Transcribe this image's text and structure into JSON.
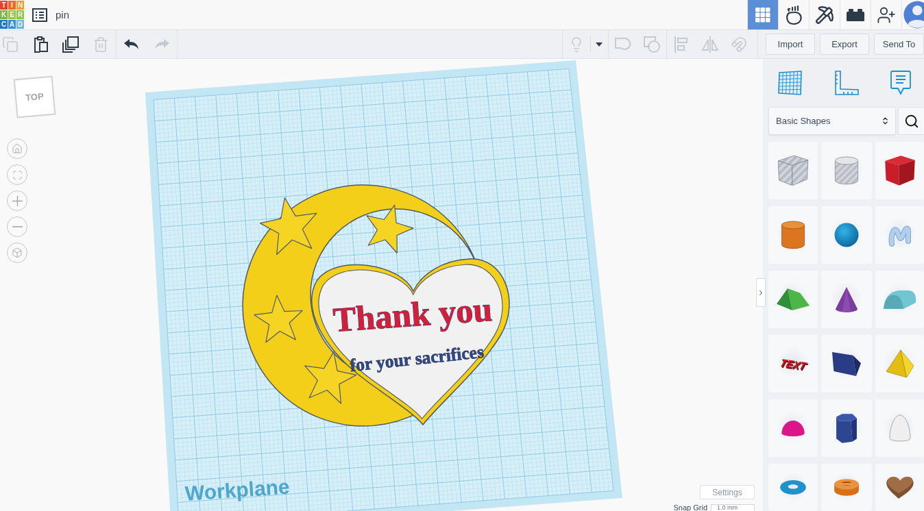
{
  "app": {
    "logo": [
      "T",
      "I",
      "N",
      "K",
      "E",
      "R",
      "C",
      "A",
      "D"
    ],
    "design_name": "pin"
  },
  "top_nav": [
    {
      "kind": "grid",
      "selected": true
    },
    {
      "kind": "gallery",
      "selected": false
    },
    {
      "kind": "pickaxe",
      "selected": false
    },
    {
      "kind": "bricks",
      "selected": false
    },
    {
      "kind": "invite",
      "selected": false
    }
  ],
  "toolbar": {
    "left_groups": [
      {
        "tools": [
          {
            "kind": "copy",
            "disabled": true
          },
          {
            "kind": "paste",
            "disabled": false
          },
          {
            "kind": "duplicate",
            "disabled": false
          },
          {
            "kind": "delete",
            "disabled": true
          }
        ]
      },
      {
        "tools": [
          {
            "kind": "undo",
            "disabled": false
          },
          {
            "kind": "redo",
            "disabled": true
          }
        ]
      }
    ],
    "right_groups": [
      {
        "tools": [
          {
            "kind": "light",
            "disabled": true
          },
          {
            "kind": "light-menu",
            "disabled": false
          }
        ]
      },
      {
        "tools": [
          {
            "kind": "group",
            "disabled": true
          },
          {
            "kind": "hole",
            "disabled": true
          }
        ]
      },
      {
        "tools": [
          {
            "kind": "align",
            "disabled": true
          },
          {
            "kind": "mirror",
            "disabled": true
          },
          {
            "kind": "cruise",
            "disabled": true
          }
        ]
      }
    ],
    "buttons": [
      "Import",
      "Export",
      "Send To"
    ]
  },
  "view_cube": {
    "face": "TOP"
  },
  "workplane": {
    "label": "Workplane",
    "design": {
      "heading": "Thank you",
      "subheading": "for your sacrifices"
    }
  },
  "grid_settings": {
    "button": "Settings",
    "snap_label": "Snap Grid",
    "snap_value": "1.0 mm"
  },
  "shapes_panel": {
    "library": "Basic Shapes",
    "shapes": [
      {
        "kind": "box-hole"
      },
      {
        "kind": "cylinder-hole"
      },
      {
        "kind": "box"
      },
      {
        "kind": "cylinder"
      },
      {
        "kind": "sphere"
      },
      {
        "kind": "scribble"
      },
      {
        "kind": "roof"
      },
      {
        "kind": "cone"
      },
      {
        "kind": "round-roof"
      },
      {
        "kind": "text",
        "label": "TEXT"
      },
      {
        "kind": "polygon"
      },
      {
        "kind": "pyramid"
      },
      {
        "kind": "half-sphere"
      },
      {
        "kind": "hex-prism"
      },
      {
        "kind": "paraboloid"
      },
      {
        "kind": "torus"
      },
      {
        "kind": "tube"
      },
      {
        "kind": "heart"
      }
    ]
  }
}
